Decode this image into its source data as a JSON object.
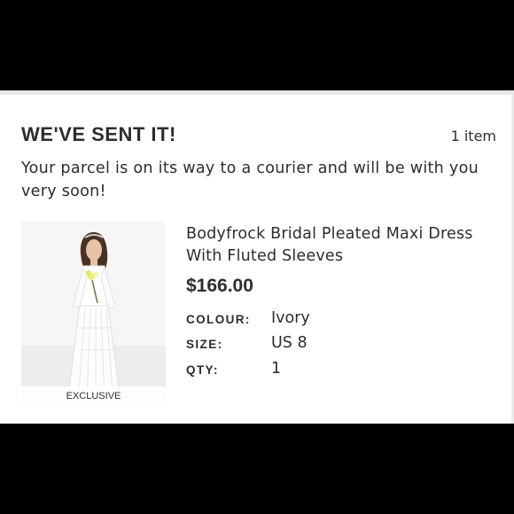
{
  "order": {
    "status_title": "WE'VE SENT IT!",
    "item_count": "1 item",
    "message": "Your parcel is on its way to a courier and will be with you very soon!"
  },
  "product": {
    "image_alt": "bride-in-white-pleated-maxi-dress",
    "badge": "EXCLUSIVE",
    "name": "Bodyfrock Bridal Pleated Maxi Dress With Fluted Sleeves",
    "price": "$166.00",
    "attributes": [
      {
        "label": "COLOUR:",
        "value": "Ivory"
      },
      {
        "label": "SIZE:",
        "value": "US 8"
      },
      {
        "label": "QTY:",
        "value": "1"
      }
    ]
  },
  "colors": {
    "text": "#2d2d2d",
    "background": "#ffffff",
    "letterbox": "#000000"
  }
}
